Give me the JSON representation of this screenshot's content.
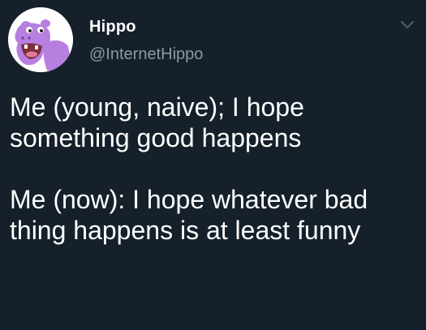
{
  "author": {
    "display_name": "Hippo",
    "handle": "@InternetHippo",
    "avatar_icon": "hippo-avatar-icon"
  },
  "menu": {
    "icon": "chevron-down-icon"
  },
  "tweet": {
    "paragraphs": [
      "Me (young, naive); I hope\nsomething good happens",
      "Me (now): I hope whatever bad\nthing happens is at least funny"
    ]
  },
  "colors": {
    "background": "#15202b",
    "text": "#ffffff",
    "secondary_text": "#8899a6",
    "avatar_purple": "#b67fe0"
  }
}
